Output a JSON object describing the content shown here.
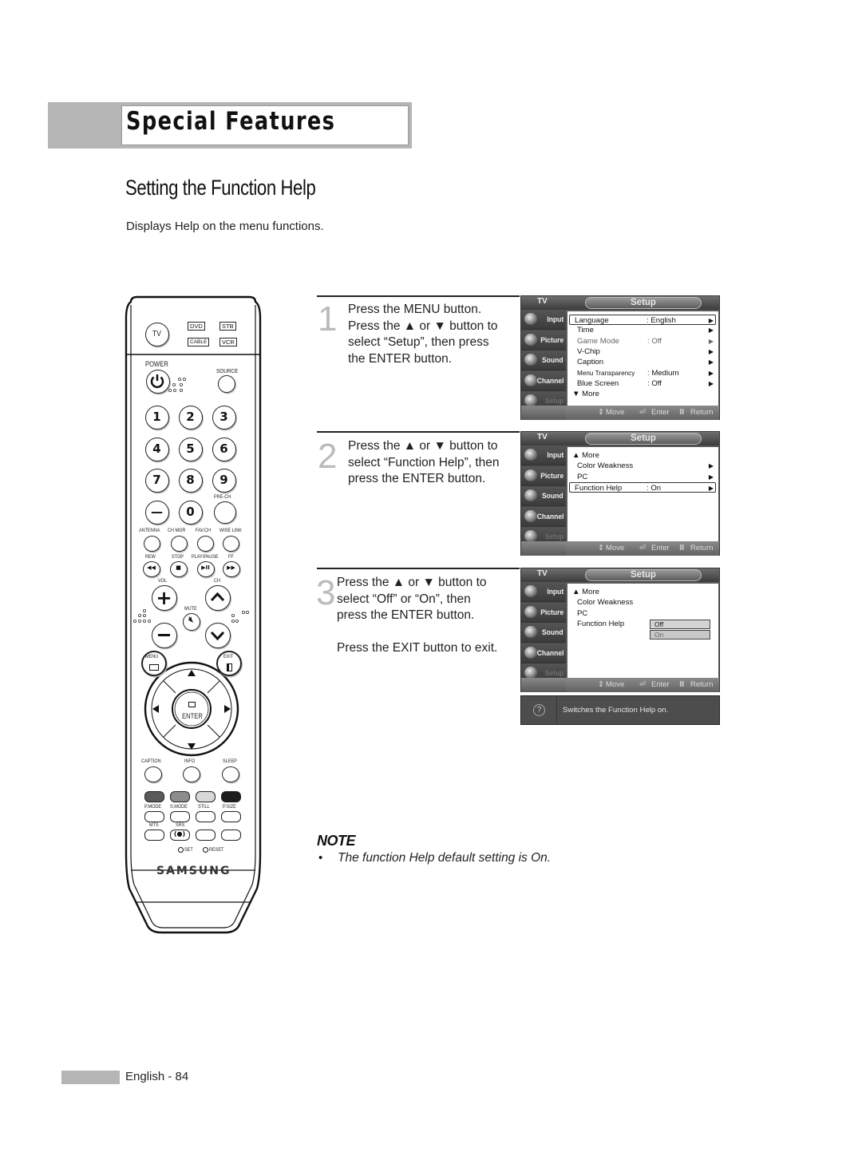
{
  "header": {
    "chapter_title": "Special Features"
  },
  "section": {
    "title": "Setting the Function Help",
    "intro": "Displays Help on the menu functions."
  },
  "steps": [
    {
      "number": "1",
      "lines": [
        "Press the MENU button.",
        "Press the ▲ or ▼ button to",
        "select “Setup”, then press",
        "the ENTER button."
      ]
    },
    {
      "number": "2",
      "lines": [
        "Press the ▲ or ▼ button to",
        "select “Function Help”, then",
        "press the ENTER button."
      ]
    },
    {
      "number": "3",
      "lines": [
        "Press the ▲ or ▼ button to",
        "select “Off” or “On”, then",
        "press the ENTER button."
      ],
      "extra": "Press the EXIT button to exit."
    }
  ],
  "osd": {
    "tv_label": "TV",
    "tab_title": "Setup",
    "sidebar": [
      {
        "label": "Input",
        "icon": "input-icon"
      },
      {
        "label": "Picture",
        "icon": "picture-icon"
      },
      {
        "label": "Sound",
        "icon": "sound-icon"
      },
      {
        "label": "Channel",
        "icon": "channel-icon"
      },
      {
        "label": "Setup",
        "icon": "setup-icon"
      }
    ],
    "footer": {
      "move": "Move",
      "enter": "Enter",
      "return": "Return"
    },
    "screen1": [
      {
        "label": "Language",
        "value": ": English",
        "arrow": "▶",
        "selected": true
      },
      {
        "label": "Time",
        "value": "",
        "arrow": "▶"
      },
      {
        "label": "Game Mode",
        "value": ": Off",
        "arrow": "▶",
        "grey": true
      },
      {
        "label": "V-Chip",
        "value": "",
        "arrow": "▶"
      },
      {
        "label": "Caption",
        "value": "",
        "arrow": "▶"
      },
      {
        "label": "Menu Transparency",
        "value": ": Medium",
        "arrow": "▶"
      },
      {
        "label": "Blue Screen",
        "value": ": Off",
        "arrow": "▶"
      },
      {
        "label": "▼ More",
        "value": "",
        "arrow": ""
      }
    ],
    "screen2": [
      {
        "label": "▲ More",
        "value": "",
        "arrow": ""
      },
      {
        "label": "Color Weakness",
        "value": "",
        "arrow": "▶"
      },
      {
        "label": "PC",
        "value": "",
        "arrow": "▶"
      },
      {
        "label": "Function Help",
        "value": ": On",
        "arrow": "▶",
        "selected": true
      }
    ],
    "screen3": [
      {
        "label": "▲ More"
      },
      {
        "label": "Color Weakness"
      },
      {
        "label": "PC"
      },
      {
        "label": "Function Help"
      }
    ],
    "screen3_options": [
      "Off",
      "On"
    ],
    "help_text": "Switches the Function Help on."
  },
  "remote": {
    "mode_buttons": {
      "tv": "TV",
      "dvd": "DVD",
      "stb": "STB",
      "cable": "CABLE",
      "vcr": "VCR"
    },
    "power": "POWER",
    "source": "SOURCE",
    "digits": [
      "1",
      "2",
      "3",
      "4",
      "5",
      "6",
      "7",
      "8",
      "9",
      "—",
      "0"
    ],
    "pre_ch": "PRE-CH",
    "row_labels": [
      "ANTENNA",
      "CH MGR",
      "FAV.CH",
      "WISE LINK"
    ],
    "transport": [
      "REW",
      "STOP",
      "PLAY/PAUSE",
      "FF"
    ],
    "vol": "VOL",
    "ch": "CH",
    "mute": "MUTE",
    "menu": "MENU",
    "exit": "EXIT",
    "enter": "ENTER",
    "func_labels": [
      "CAPTION",
      "INFO",
      "SLEEP"
    ],
    "color_labels": [
      "P.MODE",
      "S.MODE",
      "STILL",
      "P.SIZE"
    ],
    "bottom_labels": [
      "MTS",
      "SRS"
    ],
    "set": "SET",
    "reset": "RESET",
    "brand": "SAMSUNG",
    "color_keys": [
      "#5a5a5a",
      "#8c8c8c",
      "#d8d8d8",
      "#1e1e1e"
    ]
  },
  "note": {
    "title": "NOTE",
    "bullet": "•",
    "text": "The function Help default setting is On."
  },
  "footer": {
    "page_label": "English - 84"
  }
}
